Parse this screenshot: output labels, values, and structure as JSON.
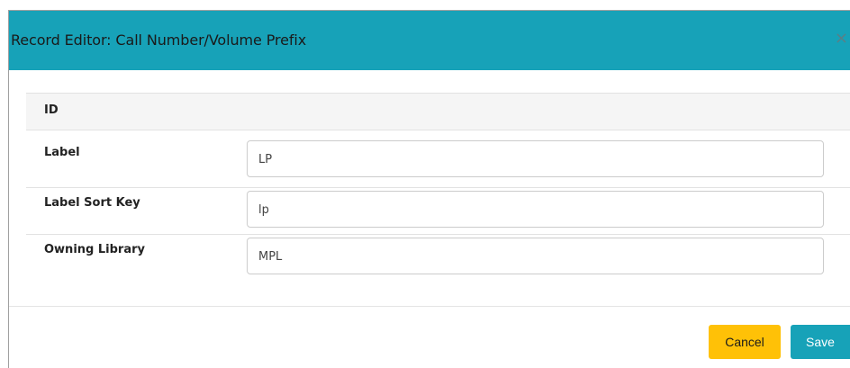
{
  "dialog": {
    "title": "Record Editor: Call Number/Volume Prefix",
    "close_label": "×"
  },
  "fields": {
    "id": {
      "label": "ID"
    },
    "label": {
      "label": "Label",
      "value": "LP"
    },
    "label_sort_key": {
      "label": "Label Sort Key",
      "value": "lp"
    },
    "owning_library": {
      "label": "Owning Library",
      "value": "MPL"
    }
  },
  "footer": {
    "cancel_label": "Cancel",
    "save_label": "Save"
  },
  "colors": {
    "header": "#17a2b8",
    "cancel": "#ffc107",
    "save": "#17a2b8"
  }
}
